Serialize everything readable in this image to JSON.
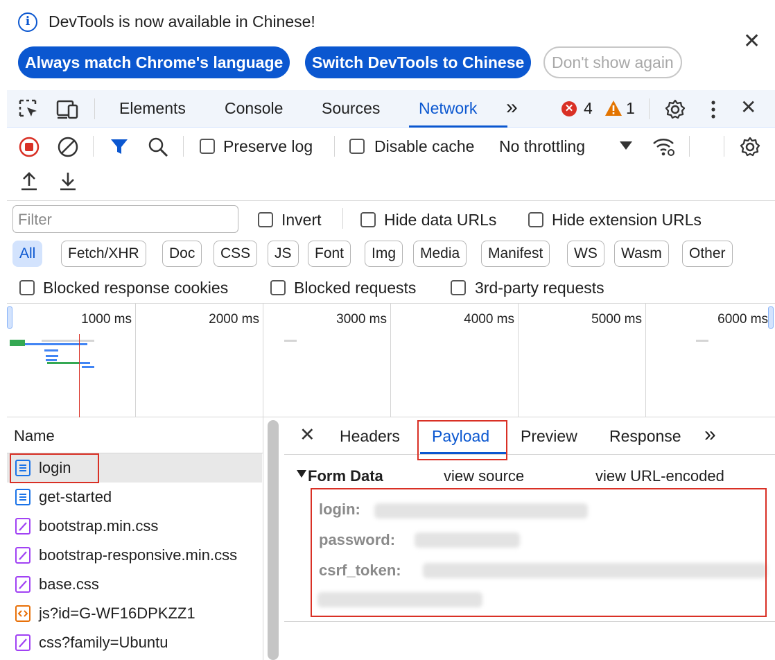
{
  "infobar": {
    "message": "DevTools is now available in Chinese!",
    "match_button": "Always match Chrome's language",
    "switch_button": "Switch DevTools to Chinese",
    "dismiss_button": "Don't show again"
  },
  "tabs": {
    "elements": "Elements",
    "console": "Console",
    "sources": "Sources",
    "network": "Network",
    "more": "»",
    "error_count": "4",
    "warning_count": "1"
  },
  "toolbar": {
    "preserve_log": "Preserve log",
    "disable_cache": "Disable cache",
    "throttling": "No throttling"
  },
  "filters": {
    "placeholder": "Filter",
    "invert": "Invert",
    "hide_data_urls": "Hide data URLs",
    "hide_extension_urls": "Hide extension URLs",
    "types": [
      "All",
      "Fetch/XHR",
      "Doc",
      "CSS",
      "JS",
      "Font",
      "Img",
      "Media",
      "Manifest",
      "WS",
      "Wasm",
      "Other"
    ],
    "blocked_cookies": "Blocked response cookies",
    "blocked_requests": "Blocked requests",
    "third_party": "3rd-party requests"
  },
  "overview": {
    "ticks": [
      "1000 ms",
      "2000 ms",
      "3000 ms",
      "4000 ms",
      "5000 ms",
      "6000 ms"
    ]
  },
  "requests": {
    "header": "Name",
    "items": [
      {
        "name": "login",
        "type": "doc"
      },
      {
        "name": "get-started",
        "type": "doc"
      },
      {
        "name": "bootstrap.min.css",
        "type": "css"
      },
      {
        "name": "bootstrap-responsive.min.css",
        "type": "css"
      },
      {
        "name": "base.css",
        "type": "css"
      },
      {
        "name": "js?id=G-WF16DPKZZ1",
        "type": "js"
      },
      {
        "name": "css?family=Ubuntu",
        "type": "css"
      }
    ]
  },
  "detail": {
    "tabs": [
      "Headers",
      "Payload",
      "Preview",
      "Response",
      "»"
    ],
    "section_title": "Form Data",
    "view_source": "view source",
    "view_url_encoded": "view URL-encoded",
    "fields": [
      "login:",
      "password:",
      "csrf_token:"
    ]
  },
  "colors": {
    "accent": "#0b57d0",
    "error": "#d93025",
    "warning": "#e37400",
    "doc_icon": "#1a73e8",
    "css_icon": "#a142f4",
    "js_icon": "#e8710a"
  }
}
